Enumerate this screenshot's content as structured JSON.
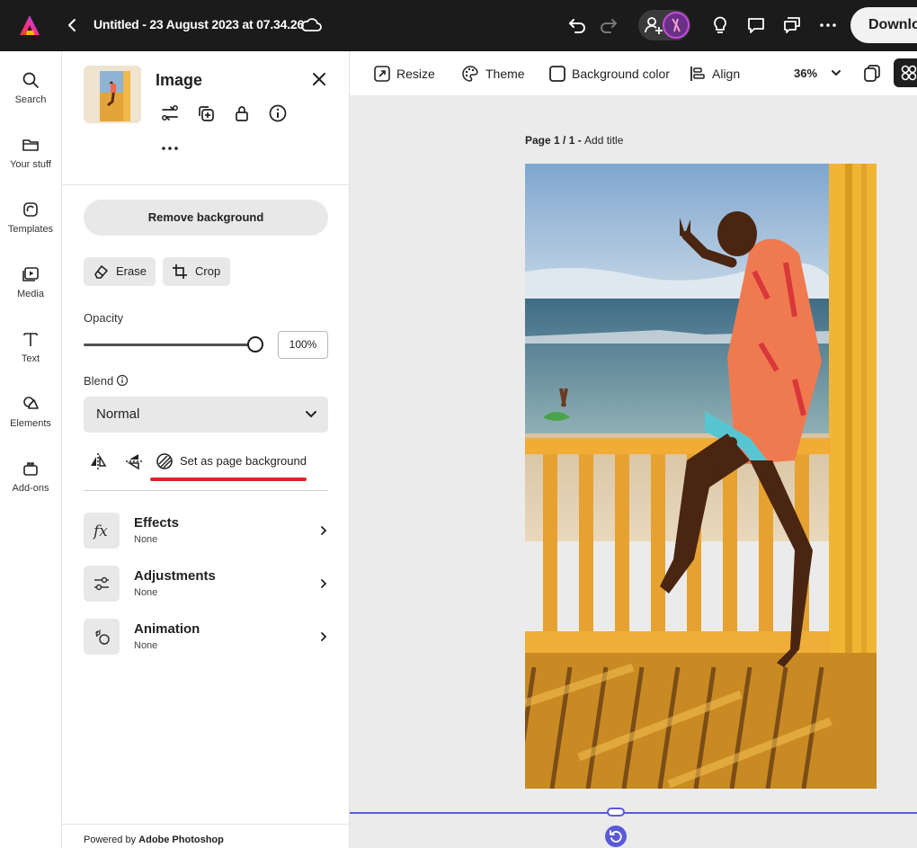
{
  "topbar": {
    "title": "Untitled - 23 August 2023 at 07.34.26",
    "download_label": "Download"
  },
  "rail": {
    "items": [
      {
        "label": "Search",
        "icon": "search-icon"
      },
      {
        "label": "Your stuff",
        "icon": "folder-icon"
      },
      {
        "label": "Templates",
        "icon": "templates-icon"
      },
      {
        "label": "Media",
        "icon": "media-icon"
      },
      {
        "label": "Text",
        "icon": "text-icon"
      },
      {
        "label": "Elements",
        "icon": "elements-icon"
      },
      {
        "label": "Add-ons",
        "icon": "add-ons-icon"
      }
    ]
  },
  "panel": {
    "title": "Image",
    "remove_bg_label": "Remove background",
    "erase_label": "Erase",
    "crop_label": "Crop",
    "opacity_label": "Opacity",
    "opacity_value": "100%",
    "opacity_level": 1.0,
    "blend_label": "Blend",
    "blend_value": "Normal",
    "set_bg_label": "Set as page background",
    "sections": [
      {
        "title": "Effects",
        "subtitle": "None",
        "icon": "fx-icon"
      },
      {
        "title": "Adjustments",
        "subtitle": "None",
        "icon": "adjustments-icon"
      },
      {
        "title": "Animation",
        "subtitle": "None",
        "icon": "animation-icon"
      }
    ],
    "powered_prefix": "Powered by",
    "powered_brand": "Adobe Photoshop"
  },
  "toolbar": {
    "resize_label": "Resize",
    "theme_label": "Theme",
    "bgcolor_label": "Background color",
    "align_label": "Align",
    "zoom_value": "36%"
  },
  "canvas": {
    "page_prefix": "Page 1 / 1 - ",
    "page_title_placeholder": "Add title"
  },
  "colors": {
    "accent": "#5a5ad8",
    "highlight": "#d7262a",
    "topbar_bg": "#1b1b1b"
  }
}
